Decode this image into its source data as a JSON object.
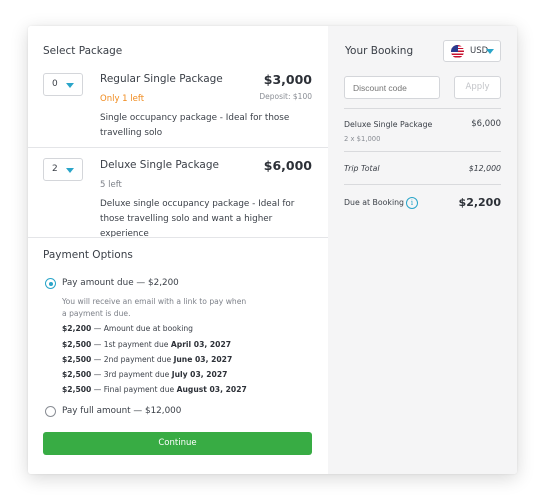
{
  "select_package": {
    "title": "Select Package",
    "packages": [
      {
        "qty": "0",
        "name": "Regular Single Package",
        "price": "$3,000",
        "availability": "Only 1 left",
        "deposit": "Deposit: $100",
        "description": "Single occupancy package - Ideal for those travelling solo"
      },
      {
        "qty": "2",
        "name": "Deluxe Single Package",
        "price": "$6,000",
        "availability": "5 left",
        "description": "Deluxe single occupancy package - Ideal for those travelling solo and want a higher experience"
      }
    ]
  },
  "payment": {
    "title": "Payment Options",
    "option_due": "Pay amount due — $2,200",
    "email_note": "You will receive an email with a link to pay when a payment is due.",
    "schedule": [
      {
        "amount": "$2,200",
        "text": " — Amount due at booking",
        "date": ""
      },
      {
        "amount": "$2,500",
        "text": " — 1st payment due ",
        "date": "April 03, 2027"
      },
      {
        "amount": "$2,500",
        "text": " — 2nd payment due ",
        "date": "June 03, 2027"
      },
      {
        "amount": "$2,500",
        "text": " — 3rd payment due ",
        "date": "July 03, 2027"
      },
      {
        "amount": "$2,500",
        "text": " — Final payment due ",
        "date": "August 03, 2027"
      }
    ],
    "option_full": "Pay full amount — $12,000",
    "continue_label": "Continue"
  },
  "booking": {
    "title": "Your Booking",
    "currency": "USD",
    "discount_placeholder": "Discount code",
    "apply_label": "Apply",
    "line_item_name": "Deluxe Single Package",
    "line_item_detail": "2 x $1,000",
    "line_item_price": "$6,000",
    "trip_total_label": "Trip Total",
    "trip_total_value": "$12,000",
    "due_label": "Due at Booking",
    "due_value": "$2,200"
  },
  "colors": {
    "accent": "#2aa5c9",
    "continue_green": "#38ac44",
    "warning_orange": "#f08a1c"
  }
}
